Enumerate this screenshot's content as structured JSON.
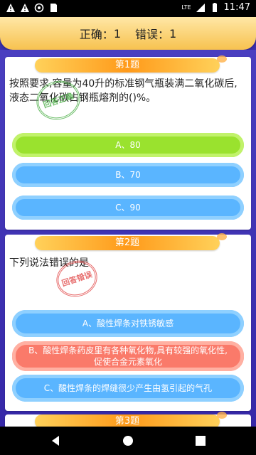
{
  "statusbar": {
    "time": "11:47",
    "network": "LTE"
  },
  "header": {
    "correct_label": "正确：",
    "correct_count": "1",
    "wrong_label": "错误：",
    "wrong_count": "1"
  },
  "questions": [
    {
      "banner": "第1题",
      "text": "按照要求,容量为40升的标准钢气瓶装满二氧化碳后,液态二氧化碳占钢瓶熔剂的()%。",
      "stamp": "回答正确",
      "options": [
        {
          "label": "A、80",
          "state": "correct"
        },
        {
          "label": "B、70",
          "state": "normal"
        },
        {
          "label": "C、90",
          "state": "normal"
        }
      ]
    },
    {
      "banner": "第2题",
      "text": "下列说法错误的是",
      "stamp": "回答错误",
      "options": [
        {
          "label": "A、酸性焊条对铁锈敏感",
          "state": "normal"
        },
        {
          "label": "B、酸性焊条药皮里有各种氧化物,具有较强的氧化性,促使合金元素氧化",
          "state": "wrong"
        },
        {
          "label": "C、酸性焊条的焊缝很少产生由氢引起的气孔",
          "state": "normal"
        }
      ]
    },
    {
      "banner": "第3题"
    }
  ],
  "colors": {
    "background": "#3a2fb0",
    "correct": "#9ae22e",
    "wrong": "#fa7a6a",
    "option": "#5ab5ff"
  }
}
